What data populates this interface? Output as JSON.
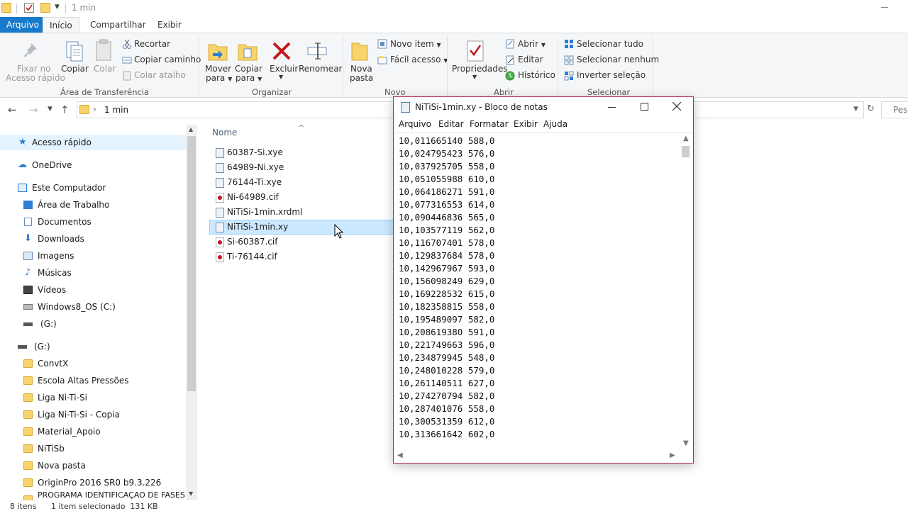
{
  "window": {
    "title": "1 min"
  },
  "ribbon_tabs": [
    "Arquivo",
    "Início",
    "Compartilhar",
    "Exibir"
  ],
  "ribbon": {
    "clipboard": {
      "pin": "Fixar no",
      "pin2": "Acesso rápido",
      "copy": "Copiar",
      "paste": "Colar",
      "cut": "Recortar",
      "copy_path": "Copiar caminho",
      "paste_shortcut": "Colar atalho",
      "group": "Área de Transferência"
    },
    "organize": {
      "move": "Mover",
      "move2": "para",
      "copy_to": "Copiar",
      "copy_to2": "para",
      "delete": "Excluir",
      "rename": "Renomear",
      "group": "Organizar"
    },
    "new": {
      "new_folder": "Nova",
      "new_folder2": "pasta",
      "new_item": "Novo item",
      "easy_access": "Fácil acesso",
      "group": "Novo"
    },
    "open": {
      "properties": "Propriedades",
      "open": "Abrir",
      "edit": "Editar",
      "history": "Histórico",
      "group": "Abrir"
    },
    "select": {
      "select_all": "Selecionar tudo",
      "select_none": "Selecionar nenhum",
      "invert": "Inverter seleção",
      "group": "Selecionar"
    }
  },
  "address": {
    "path": "1 min",
    "search_placeholder": "Pes"
  },
  "nav_pane": [
    {
      "label": "Acesso rápido",
      "icon": "star-icon"
    },
    {
      "label": "OneDrive",
      "icon": "cloud-icon"
    },
    {
      "label": "Este Computador",
      "icon": "computer-icon"
    },
    {
      "label": "Área de Trabalho",
      "icon": "desktop-icon"
    },
    {
      "label": "Documentos",
      "icon": "document-icon"
    },
    {
      "label": "Downloads",
      "icon": "download-icon"
    },
    {
      "label": "Imagens",
      "icon": "image-icon"
    },
    {
      "label": "Músicas",
      "icon": "music-icon"
    },
    {
      "label": "Vídeos",
      "icon": "video-icon"
    },
    {
      "label": "Windows8_OS (C:)",
      "icon": "drive-icon"
    },
    {
      "label": "(G:)",
      "icon": "drive-icon"
    },
    {
      "label": "(G:)",
      "icon": "drive-icon"
    },
    {
      "label": "ConvtX",
      "icon": "folder-icon"
    },
    {
      "label": "Escola Altas Pressões",
      "icon": "folder-icon"
    },
    {
      "label": "Liga Ni-Ti-Si",
      "icon": "folder-icon"
    },
    {
      "label": "Liga Ni-Ti-Si - Copia",
      "icon": "folder-icon"
    },
    {
      "label": "Material_Apoio",
      "icon": "folder-icon"
    },
    {
      "label": "NiTiSb",
      "icon": "folder-icon"
    },
    {
      "label": "Nova pasta",
      "icon": "folder-icon"
    },
    {
      "label": "OriginPro 2016 SR0 b9.3.226",
      "icon": "folder-icon"
    },
    {
      "label": "PROGRAMA IDENTIFICAÇÃO DE FASES",
      "icon": "folder-icon"
    }
  ],
  "file_list": {
    "column_name": "Nome",
    "files": [
      {
        "name": "60387-Si.xye",
        "type": "txt"
      },
      {
        "name": "64989-Ni.xye",
        "type": "txt"
      },
      {
        "name": "76144-Ti.xye",
        "type": "txt"
      },
      {
        "name": "Ni-64989.cif",
        "type": "cif"
      },
      {
        "name": "NiTiSi-1min.xrdml",
        "type": "txt"
      },
      {
        "name": "NiTiSi-1min.xy",
        "type": "txt",
        "selected": true
      },
      {
        "name": "Si-60387.cif",
        "type": "cif"
      },
      {
        "name": "Ti-76144.cif",
        "type": "cif"
      }
    ]
  },
  "status": {
    "count": "8 itens",
    "selection": "1 item selecionado  131 KB"
  },
  "notepad": {
    "title": "NiTiSi-1min.xy - Bloco de notas",
    "menu": [
      "Arquivo",
      "Editar",
      "Formatar",
      "Exibir",
      "Ajuda"
    ],
    "content": "10,011665140 588,0\n10,024795423 576,0\n10,037925705 558,0\n10,051055988 610,0\n10,064186271 591,0\n10,077316553 614,0\n10,090446836 565,0\n10,103577119 562,0\n10,116707401 578,0\n10,129837684 578,0\n10,142967967 593,0\n10,156098249 629,0\n10,169228532 615,0\n10,182358815 558,0\n10,195489097 582,0\n10,208619380 591,0\n10,221749663 596,0\n10,234879945 548,0\n10,248010228 579,0\n10,261140511 627,0\n10,274270794 582,0\n10,287401076 558,0\n10,300531359 612,0\n10,313661642 602,0"
  },
  "colors": {
    "accent": "#1979ca",
    "selection": "#cce8ff",
    "notepad_border": "#b1254b",
    "delete_red": "#c4161c"
  }
}
